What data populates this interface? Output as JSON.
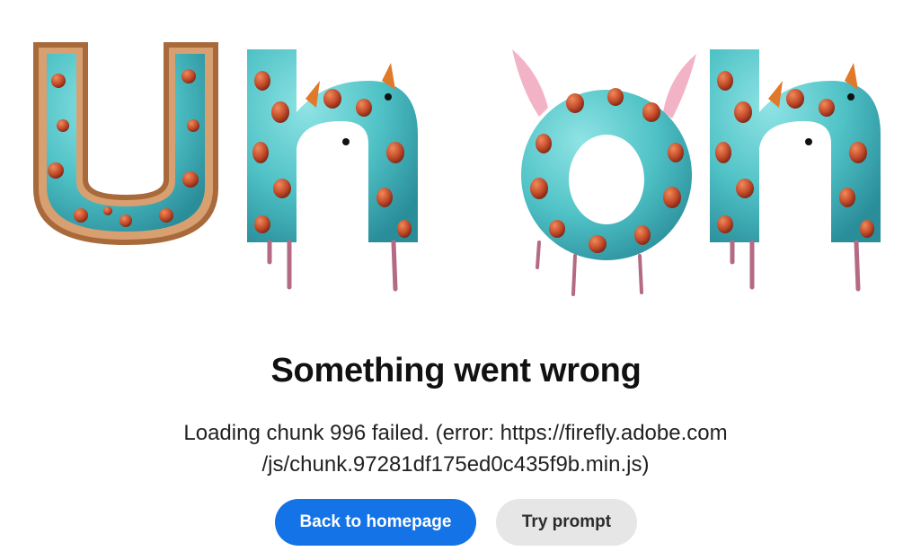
{
  "error": {
    "heading": "Something went wrong",
    "message_line1": "Loading chunk 996 failed. (error: https://firefly.adobe.com",
    "message_line2": "/js/chunk.97281df175ed0c435f9b.min.js)"
  },
  "actions": {
    "primary_label": "Back to homepage",
    "secondary_label": "Try prompt"
  },
  "illustration": {
    "letters": [
      "U",
      "h",
      "o",
      "h"
    ],
    "colors": {
      "body": "#56c6c9",
      "body_dark": "#2f9aa6",
      "spots": "#c0462a",
      "drips": "#b56a84",
      "crust": "#d8a070",
      "fins": "#f0a0b8"
    }
  },
  "colors": {
    "primary": "#1473e6",
    "secondary": "#e6e6e6"
  }
}
